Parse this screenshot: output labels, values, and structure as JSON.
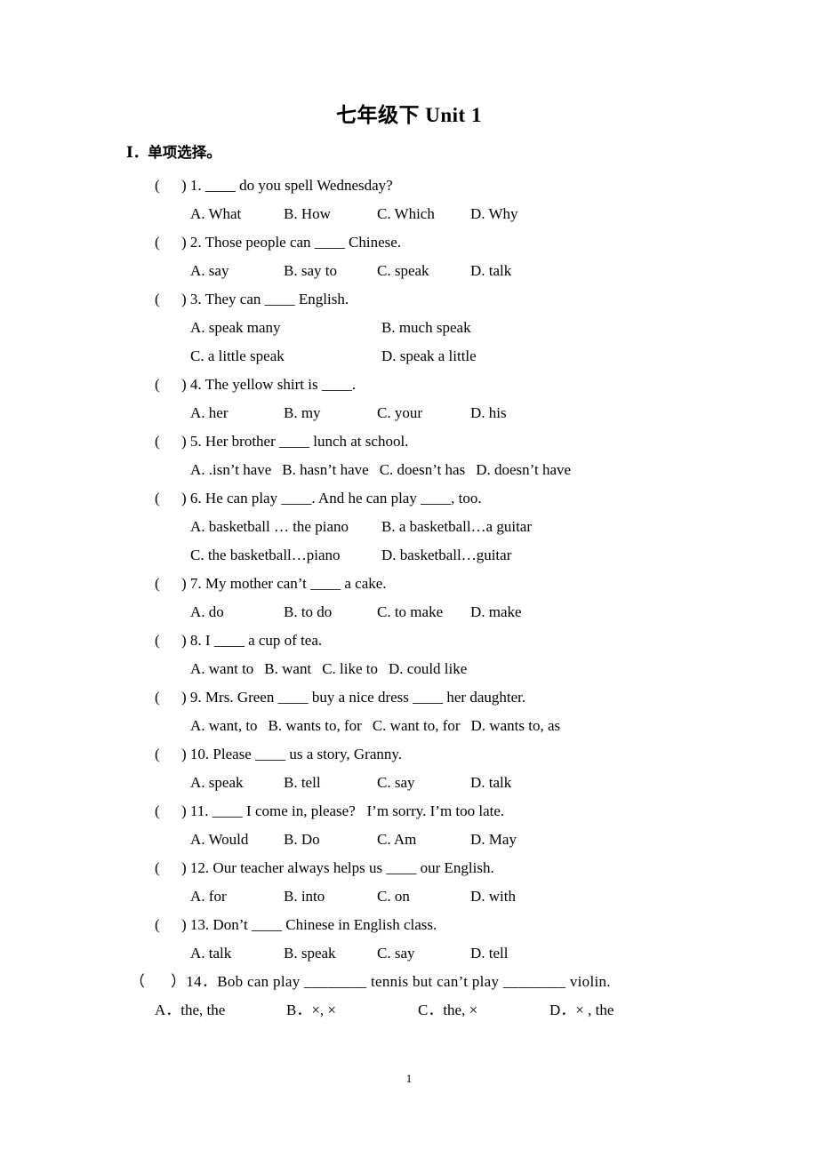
{
  "document": {
    "title": "七年级下 Unit 1",
    "page_number": "1"
  },
  "section": {
    "heading": "Ⅰ．单项选择。"
  },
  "questions": [
    {
      "marker": "(",
      "marker_close": ") 1. ",
      "stem": "____ do you spell Wednesday?",
      "layout": "cols",
      "options": [
        "A. What",
        "B. How",
        "C. Which",
        "D. Why"
      ]
    },
    {
      "marker": "(",
      "marker_close": ") 2. ",
      "stem": "Those people can ____ Chinese.",
      "layout": "cols",
      "options": [
        "A. say",
        "B. say to",
        "C. speak",
        "D. talk"
      ]
    },
    {
      "marker": "(",
      "marker_close": ") 3. ",
      "stem": "They can ____ English.",
      "layout": "two",
      "options": [
        "A. speak many",
        "B. much speak",
        "C. a little speak",
        "D. speak a little"
      ]
    },
    {
      "marker": "(",
      "marker_close": ") 4. ",
      "stem": "The yellow shirt is ____.",
      "layout": "cols",
      "options": [
        "A. her",
        "B. my",
        "C. your",
        "D. his"
      ]
    },
    {
      "marker": "(",
      "marker_close": ") 5. ",
      "stem": "Her brother ____ lunch at school.",
      "layout": "tight",
      "options": [
        "A. .isn’t have",
        "B. hasn’t have",
        "C. doesn’t has",
        "D. doesn’t have"
      ]
    },
    {
      "marker": "(",
      "marker_close": ") 6. ",
      "stem": "He can play ____. And he can play ____, too.",
      "layout": "two",
      "options": [
        "A. basketball … the piano",
        "B. a basketball…a guitar",
        "C. the basketball…piano",
        "D. basketball…guitar"
      ]
    },
    {
      "marker": "(",
      "marker_close": ") 7. ",
      "stem": "My mother can’t ____ a cake.",
      "layout": "cols",
      "options": [
        "A. do",
        "B. to do",
        "C. to make",
        "D. make"
      ]
    },
    {
      "marker": "(",
      "marker_close": ") 8. ",
      "stem": "I ____ a cup of tea.",
      "layout": "tight",
      "options": [
        "A. want to",
        "B. want",
        "C. like to",
        "D. could like"
      ]
    },
    {
      "marker": "(",
      "marker_close": ") 9. ",
      "stem": "Mrs. Green ____ buy a nice dress ____ her daughter.",
      "layout": "tight",
      "options": [
        "A. want, to",
        "B. wants to, for",
        "C. want to, for",
        "D. wants to, as"
      ]
    },
    {
      "marker": "(",
      "marker_close": ") 10. ",
      "stem": "Please ____ us a story, Granny.",
      "layout": "cols",
      "options": [
        "A. speak",
        "B. tell",
        "C. say",
        "D. talk"
      ]
    },
    {
      "marker": "(",
      "marker_close": ") 11. ",
      "stem": "____ I come in, please?   I’m sorry. I’m too late.",
      "layout": "cols",
      "options": [
        "A. Would",
        "B. Do",
        "C. Am",
        "D. May"
      ]
    },
    {
      "marker": "(",
      "marker_close": ") 12. ",
      "stem": "Our teacher always helps us ____ our English.",
      "layout": "cols",
      "options": [
        "A. for",
        "B. into",
        "C. on",
        "D. with"
      ]
    },
    {
      "marker": "(",
      "marker_close": ") 13. ",
      "stem": "Don’t ____ Chinese in English class.",
      "layout": "cols",
      "options": [
        "A. talk",
        "B. speak",
        "C. say",
        "D. tell"
      ]
    },
    {
      "marker": "（",
      "marker_close": "）14．",
      "stem": "Bob can play ________ tennis but can’t play ________ violin.",
      "layout": "wide",
      "options": [
        "A．the, the",
        "B．×, ×",
        "C．the, ×",
        "D．× , the"
      ]
    }
  ]
}
